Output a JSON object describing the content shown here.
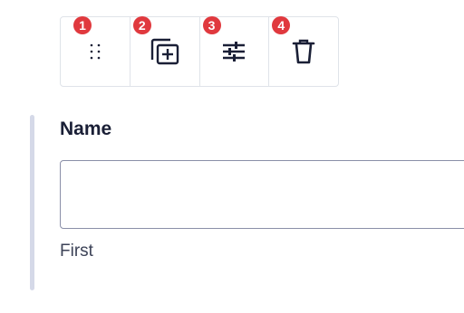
{
  "toolbar": {
    "buttons": [
      {
        "badge": "1",
        "icon": "drag-handle-icon",
        "action": "move"
      },
      {
        "badge": "2",
        "icon": "duplicate-icon",
        "action": "duplicate"
      },
      {
        "badge": "3",
        "icon": "settings-sliders-icon",
        "action": "settings"
      },
      {
        "badge": "4",
        "icon": "trash-icon",
        "action": "delete"
      }
    ]
  },
  "field": {
    "label": "Name",
    "value": "",
    "sublabel": "First"
  },
  "colors": {
    "badge": "#e0393e",
    "rail": "#d5d9e8",
    "text_dark": "#1a1f36",
    "border": "#dfe3e9"
  }
}
